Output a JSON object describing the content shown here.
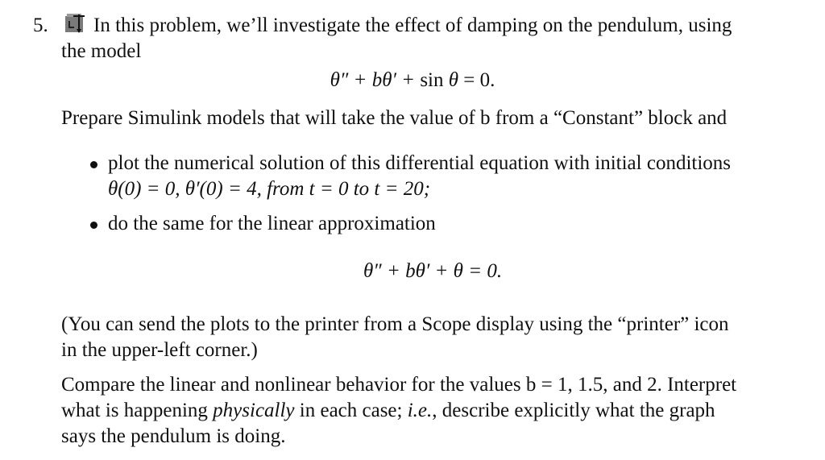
{
  "problem": {
    "number": "5.",
    "icon": "simulink-icon",
    "intro_line1": "In this problem, we’ll investigate the effect of damping on the pendulum, using",
    "intro_line2": "the model",
    "equation_nonlinear": {
      "lhs_a": "θ″ + ",
      "b": "b",
      "lhs_b": "θ′ + ",
      "sin": "sin ",
      "theta": "θ",
      "rhs": " = 0."
    },
    "prepare": "Prepare Simulink models that will take the value of b from a “Constant” block and",
    "bullets": [
      {
        "line1": "plot the numerical solution of this differential equation with initial conditions",
        "line2": "θ(0) = 0, θ′(0) = 4, from t = 0 to t = 20;"
      },
      {
        "line1": "do the same for the linear approximation"
      }
    ],
    "equation_linear": "θ″ + bθ′ + θ = 0.",
    "printer_note_line1": "(You can send the plots to the printer from a Scope display using the “printer” icon",
    "printer_note_line2": "in the upper-left corner.)",
    "compare_line1": "Compare the linear and nonlinear behavior for the values b = 1, 1.5, and 2. Interpret",
    "compare_line2_a": "what is happening ",
    "compare_line2_em": "physically",
    "compare_line2_b": " in each case; ",
    "compare_line2_ie": "i.e.",
    "compare_line2_c": ", describe explicitly what the graph",
    "compare_line3": "says the pendulum is doing."
  }
}
